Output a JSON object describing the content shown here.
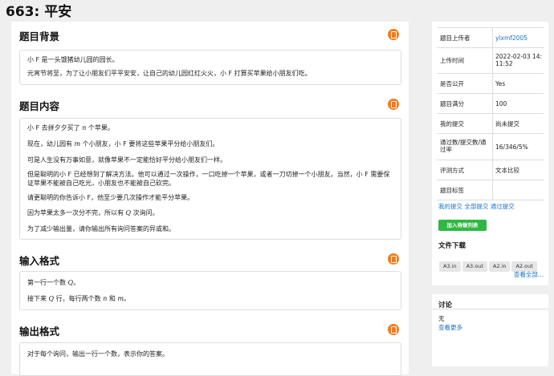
{
  "page_title": "663: 平安",
  "sections": {
    "background": {
      "heading": "题目背景",
      "lines": [
        "小 F 是一头饿猪幼儿园的园长。",
        "元宵节将至，为了让小朋友们平平安安，让自己的幼儿园红红火火，小 F 打算买苹果给小朋友们吃。"
      ]
    },
    "content": {
      "heading": "题目内容",
      "l1a": "小 F 去拼夕夕买了 ",
      "l1v": "n",
      "l1b": " 个苹果。",
      "l2a": "现在，幼儿园有 ",
      "l2v": "m",
      "l2b": " 个小朋友，小 F 要将这些苹果平分给小朋友们。",
      "l3": "可是人生没有万事如意，就像苹果不一定能恰好平分给小朋友们一样。",
      "l4": "但是聪明的小 F 已经想到了解决方法。他可以通过一次操作，一口吃掉一个苹果，或者一刀切掉一个小朋友。当然，小 F 需要保证苹果不能被自己吃光，小朋友也不能被自己砍完。",
      "l5": "请更聪明的你告诉小 F，他至少要几次操作才能平分苹果。",
      "l6a": "因为苹果太多一次分不完，所以有 ",
      "l6v": "Q",
      "l6b": " 次询问。",
      "l7": "为了减少输出量，请你输出所有询问答案的异或和。"
    },
    "input": {
      "heading": "输入格式",
      "l1a": "第一行一个数 ",
      "l1v": "Q",
      "l1b": "。",
      "l2a": "接下来 ",
      "l2v": "Q",
      "l2b": " 行，每行两个数 ",
      "l2v2": "n",
      "l2c": " 和 ",
      "l2v3": "m",
      "l2d": "。"
    },
    "output": {
      "heading": "输出格式",
      "l1": "对于每个询问，输出一行一个数，表示你的答案。"
    }
  },
  "info": {
    "rows": [
      {
        "k": "题目上传者",
        "v": "ylxmf2005"
      },
      {
        "k": "上传时间",
        "v": "2022-02-03 14:11:52"
      },
      {
        "k": "是否公开",
        "v": "Yes"
      },
      {
        "k": "题目满分",
        "v": "100"
      },
      {
        "k": "我的提交",
        "v": "尚未提交"
      },
      {
        "k": "通过数/提交数/通过率",
        "v": "16/346/5%"
      },
      {
        "k": "评测方式",
        "v": "文本比较"
      },
      {
        "k": "题目标签",
        "v": ""
      }
    ],
    "links": [
      "我的提交",
      "全部提交",
      "通过提交"
    ],
    "add_button": "加入待做列表",
    "files_title": "文件下载",
    "files": [
      "A3.in",
      "A3.out",
      "A2.in",
      "A2.out"
    ],
    "view_all": "查看全部..."
  },
  "discussion": {
    "heading": "讨论",
    "empty": "无",
    "view_more": "查看更多"
  },
  "colors": {
    "accent": "#f37b1d",
    "link": "#1a73c8",
    "green": "#2eb843"
  }
}
